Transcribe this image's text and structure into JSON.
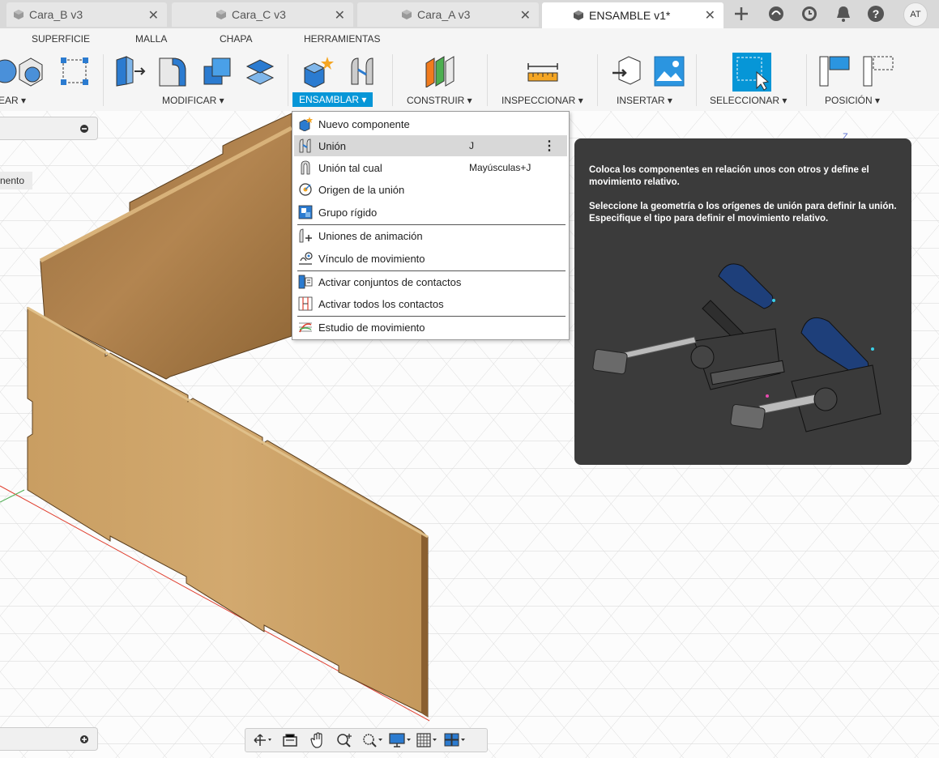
{
  "tabs": [
    {
      "label": "Cara_B v3"
    },
    {
      "label": "Cara_C v3"
    },
    {
      "label": "Cara_A v3"
    },
    {
      "label": "ENSAMBLE v1*"
    }
  ],
  "user_initials": "AT",
  "workspace_tabs": [
    "SUPERFICIE",
    "MALLA",
    "CHAPA",
    "HERRAMIENTAS"
  ],
  "groups": {
    "crear": "EAR",
    "modificar": "MODIFICAR",
    "ensamblar": "ENSAMBLAR",
    "construir": "CONSTRUIR",
    "inspeccionar": "INSPECCIONAR",
    "insertar": "INSERTAR",
    "seleccionar": "SELECCIONAR",
    "posicion": "POSICIÓN"
  },
  "menu": {
    "items": [
      {
        "label": "Nuevo componente",
        "shortcut": ""
      },
      {
        "label": "Unión",
        "shortcut": "J"
      },
      {
        "label": "Unión tal cual",
        "shortcut": "Mayúsculas+J"
      },
      {
        "label": "Origen de la unión",
        "shortcut": ""
      },
      {
        "label": "Grupo rígido",
        "shortcut": ""
      },
      {
        "label": "Uniones de animación",
        "shortcut": ""
      },
      {
        "label": "Vínculo de movimiento",
        "shortcut": ""
      },
      {
        "label": "Activar conjuntos de contactos",
        "shortcut": ""
      },
      {
        "label": "Activar todos los contactos",
        "shortcut": ""
      },
      {
        "label": "Estudio de movimiento",
        "shortcut": ""
      }
    ]
  },
  "tooltip": {
    "para1": "Coloca los componentes en relación unos con otros y define el movimiento relativo.",
    "para2": "Seleccione la geometría o los orígenes de unión para definir la unión. Especifique el tipo para definir el movimiento relativo."
  },
  "browser_partial_label": "nento",
  "viewcube_axis_label": "Z",
  "colors": {
    "accent": "#0696d7",
    "wood": "#c9a36b",
    "tooltip_bg": "#3b3b3b"
  }
}
